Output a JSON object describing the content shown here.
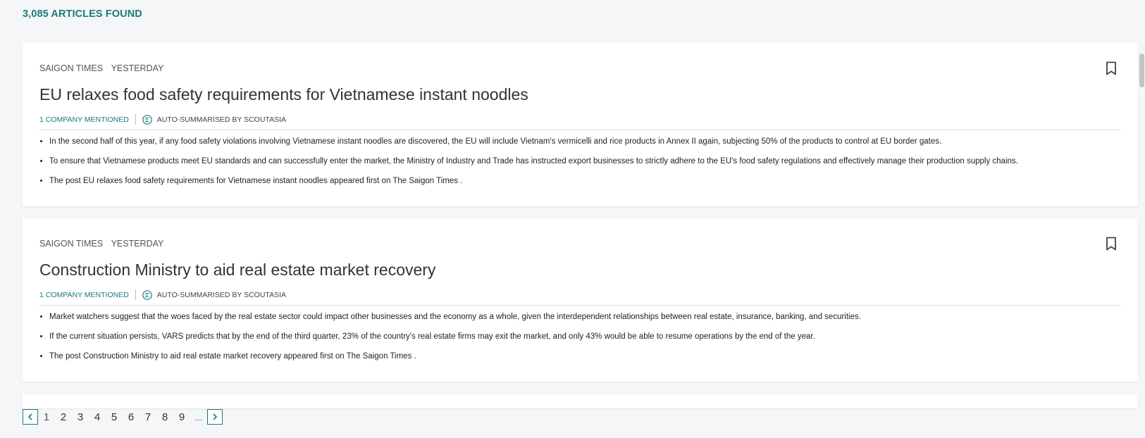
{
  "results": {
    "count_label": "3,085 ARTICLES FOUND"
  },
  "articles": [
    {
      "source": "SAIGON TIMES",
      "date": "YESTERDAY",
      "title": "EU relaxes food safety requirements for Vietnamese instant noodles",
      "company_mentions": "1 COMPANY MENTIONED",
      "summary_label": "AUTO-SUMMARISED BY SCOUTASIA",
      "bullets": [
        "In the second half of this year, if any food safety violations involving Vietnamese instant noodles are discovered, the EU will include Vietnam's vermicelli and rice products in Annex II again, subjecting 50% of the products to control at EU border gates.",
        "To ensure that Vietnamese products meet EU standards and can successfully enter the market, the Ministry of Industry and Trade has instructed export businesses to strictly adhere to the EU's food safety regulations and effectively manage their production supply chains.",
        "The post EU relaxes food safety requirements for Vietnamese instant noodles appeared first on The Saigon Times ."
      ]
    },
    {
      "source": "SAIGON TIMES",
      "date": "YESTERDAY",
      "title": "Construction Ministry to aid real estate market recovery",
      "company_mentions": "1 COMPANY MENTIONED",
      "summary_label": "AUTO-SUMMARISED BY SCOUTASIA",
      "bullets": [
        "Market watchers suggest that the woes faced by the real estate sector could impact other businesses and the economy as a whole, given the interdependent relationships between real estate, insurance, banking, and securities.",
        "If the current situation persists, VARS predicts that by the end of the third quarter, 23% of the country's real estate firms may exit the market, and only 43% would be able to resume operations by the end of the year.",
        "The post Construction Ministry to aid real estate market recovery appeared first on The Saigon Times ."
      ]
    }
  ],
  "pagination": {
    "pages": [
      "1",
      "2",
      "3",
      "4",
      "5",
      "6",
      "7",
      "8",
      "9"
    ],
    "ellipsis": "...",
    "current": "1",
    "prev_icon": "chevron-left-icon",
    "next_icon": "chevron-right-icon"
  },
  "colors": {
    "accent": "#1b7b78",
    "background": "#f4f6f8"
  }
}
